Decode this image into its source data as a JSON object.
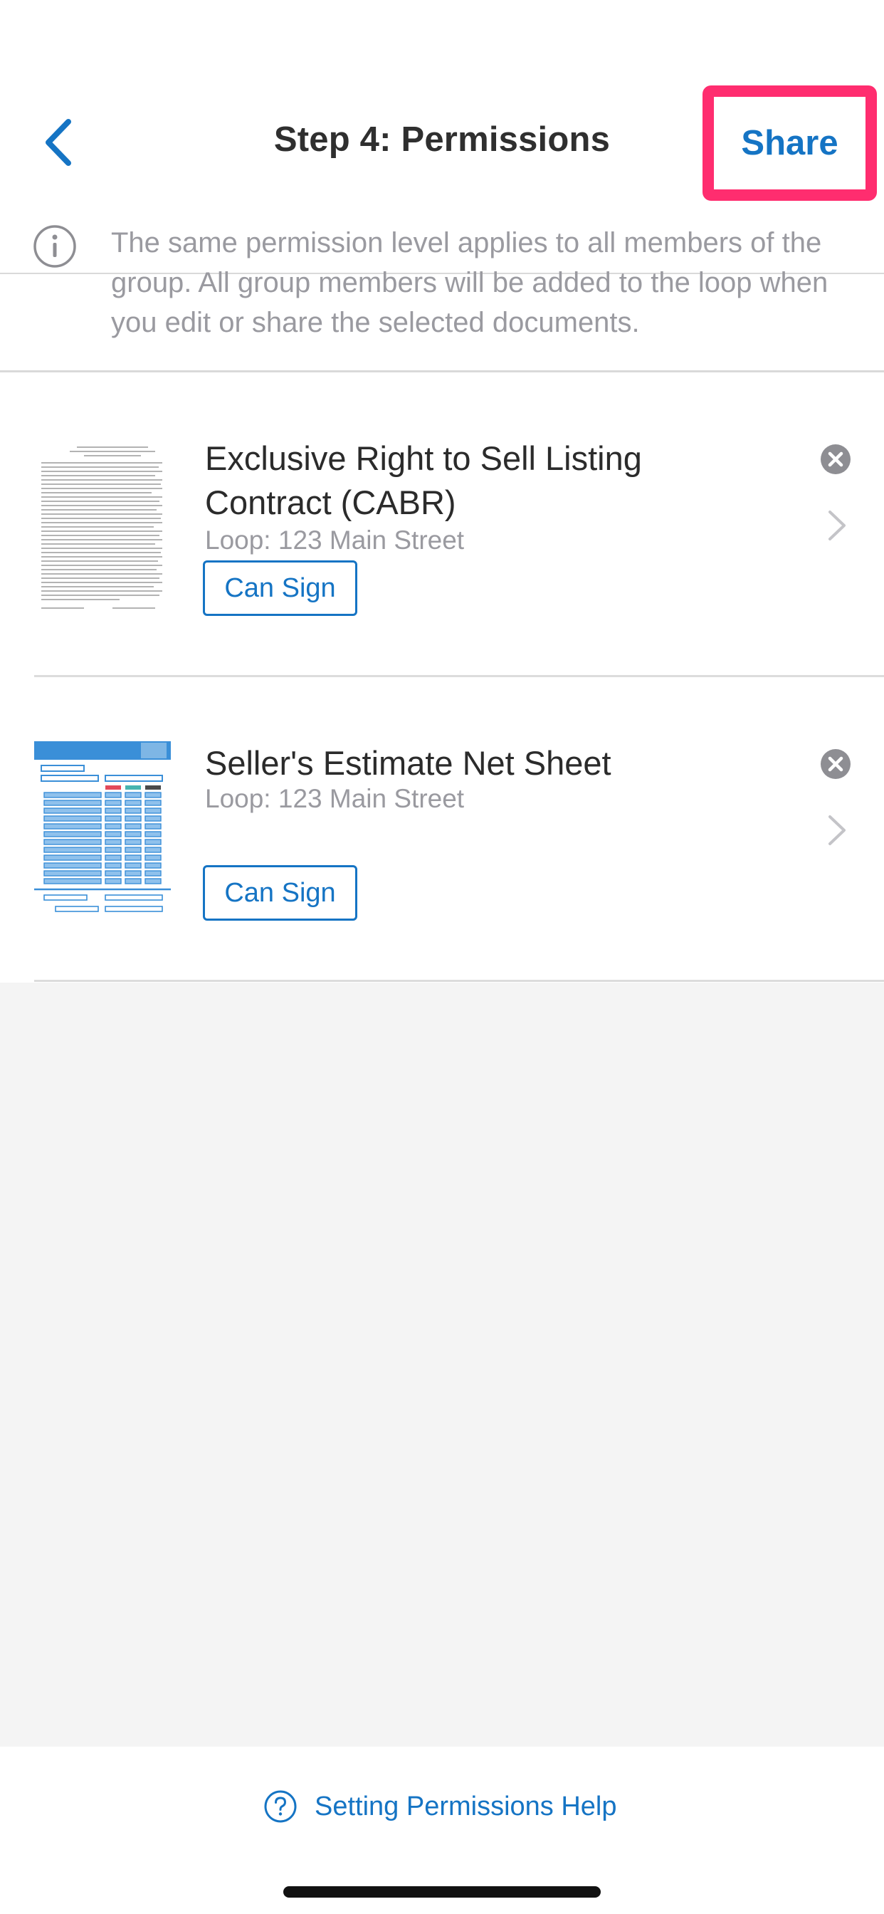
{
  "nav": {
    "title": "Step 4: Permissions",
    "share_label": "Share",
    "back_icon": "chevron-left-icon"
  },
  "info": {
    "icon": "info-icon",
    "text": "The same permission level applies to all members of the group. All group members will be added to the loop when you edit or share the selected documents."
  },
  "documents": [
    {
      "title": "Exclusive Right to Sell Listing Contract (CABR)",
      "loop": "Loop: 123 Main Street",
      "permission": "Can Sign"
    },
    {
      "title": "Seller's Estimate Net Sheet",
      "loop": "Loop: 123 Main Street",
      "permission": "Can Sign"
    }
  ],
  "help": {
    "label": "Setting Permissions Help",
    "icon": "question-circle-icon"
  },
  "colors": {
    "accent": "#1574c4",
    "highlight": "#ff2d6f",
    "muted_text": "#9a9aa0",
    "background": "#f4f4f4"
  }
}
